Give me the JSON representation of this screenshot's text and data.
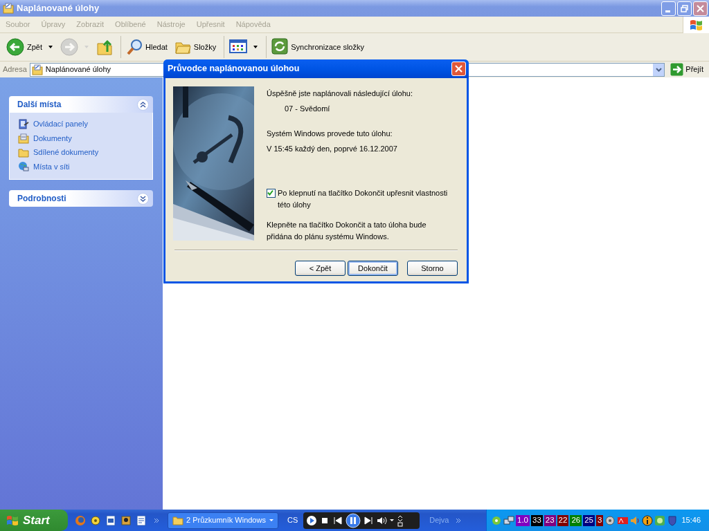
{
  "window": {
    "title": "Naplánované úlohy"
  },
  "menu_bar": {
    "disabled": true,
    "items": [
      "Soubor",
      "Úpravy",
      "Zobrazit",
      "Oblíbené",
      "Nástroje",
      "Upřesnit",
      "Nápověda"
    ]
  },
  "toolbar": [
    {
      "kind": "back",
      "label": "Zpět",
      "disabled": false
    },
    {
      "kind": "forward",
      "disabled": true
    },
    {
      "kind": "up",
      "disabled": false
    },
    {
      "kind": "search",
      "label": "Hledat",
      "disabled": false
    },
    {
      "kind": "folders",
      "label": "Složky",
      "disabled": false
    },
    {
      "kind": "views",
      "disabled": false
    },
    {
      "kind": "sync",
      "label": "Synchronizace složky",
      "disabled": false
    }
  ],
  "address_bar": {
    "label": "Adresa",
    "value": "Naplánované úlohy",
    "go_label": "Přejít"
  },
  "sidebar": {
    "panels": [
      {
        "title": "Další místa",
        "expanded": true,
        "items": [
          {
            "label": "Ovládací panely",
            "kind": "control"
          },
          {
            "label": "Dokumenty",
            "kind": "documents"
          },
          {
            "label": "Sdílené dokumenty",
            "kind": "folder"
          },
          {
            "label": "Místa v síti",
            "kind": "network"
          }
        ]
      },
      {
        "title": "Podrobnosti",
        "expanded": false
      }
    ]
  },
  "dialog": {
    "title": "Průvodce naplánovanou úlohou",
    "success_text": "Úspěšně jste naplánovali následující úlohu:",
    "task_name": "07 - Svědomí",
    "schedule_label": "Systém Windows provede tuto úlohu:",
    "schedule": "V 15:45 každý den, poprvé 16.12.2007",
    "advanced_checkbox": {
      "label": "Po klepnutí na tlačítko Dokončit upřesnit vlastnosti této úlohy",
      "checked": true
    },
    "info": "Klepněte na tlačítko Dokončit a tato úloha bude přidána do plánu systému Windows.",
    "buttons": [
      {
        "label": "< Zpět",
        "default": false
      },
      {
        "label": "Dokončit",
        "default": true
      },
      {
        "label": "Storno",
        "default": false
      }
    ]
  },
  "taskbar": {
    "start_label": "Start",
    "window_button": "2 Průzkumník Windows",
    "language": "CS",
    "toolbar_label": "Dejva",
    "tray_counters": [
      {
        "text": "1.0",
        "color": "#8000c0"
      },
      {
        "text": "33",
        "color": "#000000"
      },
      {
        "text": "23",
        "color": "#800080"
      },
      {
        "text": "22",
        "color": "#800000"
      },
      {
        "text": "26",
        "color": "#008000"
      },
      {
        "text": "25",
        "color": "#000080"
      },
      {
        "text": "3",
        "color": "#800000"
      }
    ],
    "clock": "15:46"
  }
}
